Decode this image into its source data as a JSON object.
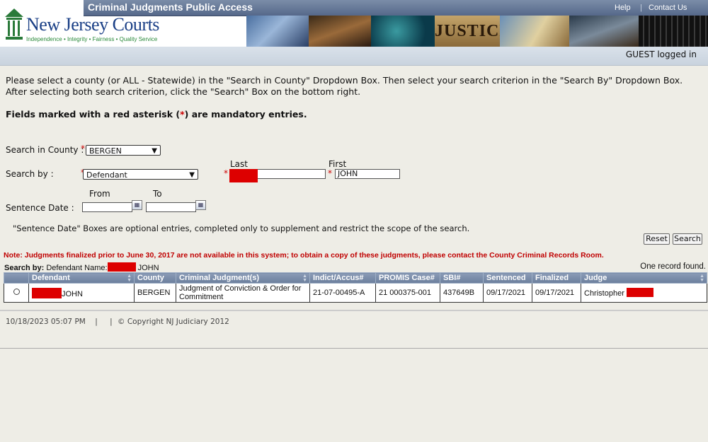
{
  "header": {
    "app_title": "Criminal Judgments Public Access",
    "help": "Help",
    "contact": "Contact Us",
    "logo_name": "New Jersey Courts",
    "logo_tagline": "Independence • Integrity • Fairness • Quality Service",
    "banner_word": "JUSTICE",
    "guest": "GUEST logged in"
  },
  "instructions": {
    "line1": "Please select a county (or ALL - Statewide) in the \"Search in County\" Dropdown Box. Then select your search criterion in the \"Search By\" Dropdown Box.",
    "line2": "After selecting both search criterion, click the \"Search\" Box on the bottom right.",
    "mandatory_pre": "Fields marked with a red asterisk (",
    "asterisk": "*",
    "mandatory_post": ") are mandatory entries."
  },
  "form": {
    "county_label": "Search in County :",
    "county_value": "BERGEN",
    "search_by_label": "Search by :",
    "search_by_value": "Defendant",
    "last_label": "Last",
    "first_label": "First",
    "first_value": "JOHN",
    "from_label": "From",
    "to_label": "To",
    "sentence_date_label": "Sentence Date :",
    "optional_note": "\"Sentence Date\" Boxes are optional entries, completed only to supplement and restrict the scope of the search.",
    "reset": "Reset",
    "search": "Search"
  },
  "note": "Note: Judgments finalized prior to June 30, 2017 are not available in this system; to obtain a copy of these judgments, please contact the County Criminal Records Room.",
  "results": {
    "search_by_prefix": "Search by:",
    "criteria_label": "Defendant Name:",
    "criteria_first": "JOHN",
    "count": "One record found.",
    "columns": [
      "Defendant",
      "County",
      "Criminal Judgment(s)",
      "Indict/Accus#",
      "PROMIS Case#",
      "SBI#",
      "Sentenced",
      "Finalized",
      "Judge"
    ],
    "rows": [
      {
        "defendant_first": "JOHN",
        "county": "BERGEN",
        "judgment": "Judgment of Conviction & Order for Commitment",
        "indict": "21-07-00495-A",
        "promis": "21 000375-001",
        "sbi": "437649B",
        "sentenced": "09/17/2021",
        "finalized": "09/17/2021",
        "judge_first": "Christopher"
      }
    ]
  },
  "footer": {
    "timestamp": "10/18/2023 05:07 PM",
    "sep1": "|",
    "sep2": "|",
    "copyright": "© Copyright NJ Judiciary 2012"
  },
  "colors": {
    "accent_red": "#cc0000",
    "header_blue": "#55688a",
    "logo_blue": "#1a3f86",
    "logo_green": "#2a8a3a"
  }
}
